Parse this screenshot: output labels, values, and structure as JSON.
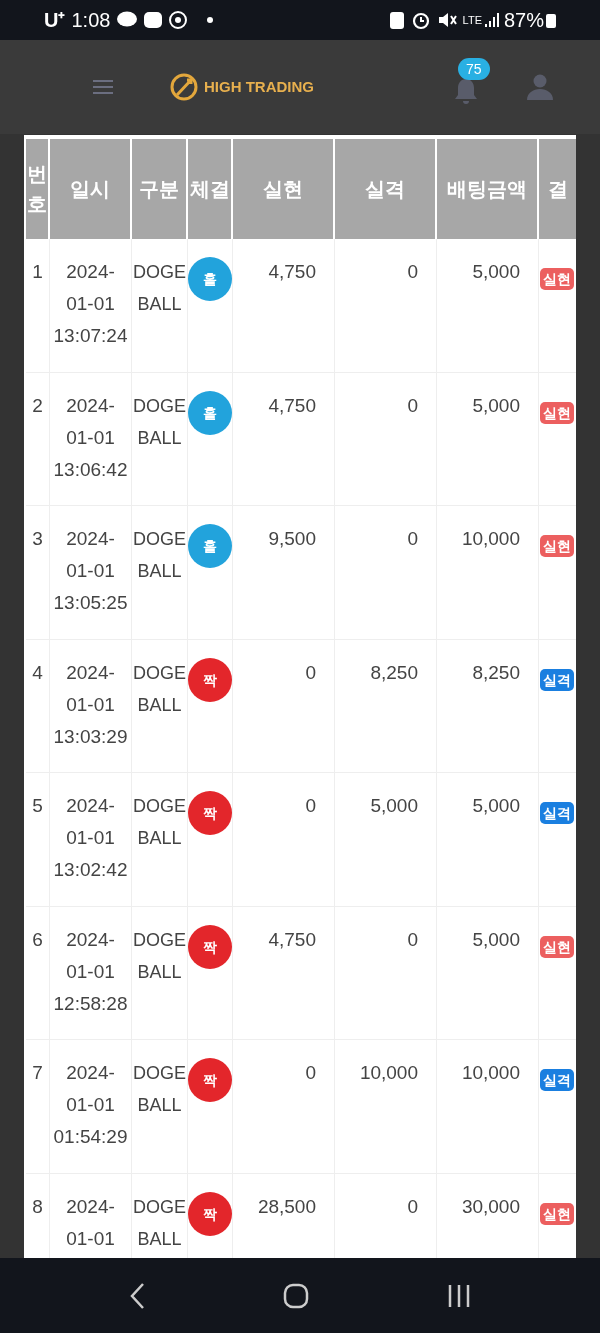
{
  "status_bar": {
    "carrier": "U⁺",
    "time": "1:08",
    "network": "LTE",
    "battery": "87%"
  },
  "header": {
    "brand": "HIGH TRADING",
    "notification_count": "75"
  },
  "table": {
    "columns": [
      "번\n호",
      "일시",
      "구분",
      "체결",
      "실현",
      "실격",
      "배팅금액",
      "결"
    ],
    "rows": [
      {
        "no": "1",
        "date": "2024-01-01",
        "time": "13:07:24",
        "game": "DOGE BALL",
        "fill": {
          "label": "홀",
          "color": "#22a3dc"
        },
        "realized": "4,750",
        "lost": "0",
        "bet": "5,000",
        "result": {
          "label": "실현",
          "color": "#ec5f5f"
        }
      },
      {
        "no": "2",
        "date": "2024-01-01",
        "time": "13:06:42",
        "game": "DOGE BALL",
        "fill": {
          "label": "홀",
          "color": "#22a3dc"
        },
        "realized": "4,750",
        "lost": "0",
        "bet": "5,000",
        "result": {
          "label": "실현",
          "color": "#ec5f5f"
        }
      },
      {
        "no": "3",
        "date": "2024-01-01",
        "time": "13:05:25",
        "game": "DOGE BALL",
        "fill": {
          "label": "홀",
          "color": "#22a3dc"
        },
        "realized": "9,500",
        "lost": "0",
        "bet": "10,000",
        "result": {
          "label": "실현",
          "color": "#ec5f5f"
        }
      },
      {
        "no": "4",
        "date": "2024-01-01",
        "time": "13:03:29",
        "game": "DOGE BALL",
        "fill": {
          "label": "짝",
          "color": "#e3262b"
        },
        "realized": "0",
        "lost": "8,250",
        "bet": "8,250",
        "result": {
          "label": "실격",
          "color": "#1a7fe0"
        }
      },
      {
        "no": "5",
        "date": "2024-01-01",
        "time": "13:02:42",
        "game": "DOGE BALL",
        "fill": {
          "label": "짝",
          "color": "#e3262b"
        },
        "realized": "0",
        "lost": "5,000",
        "bet": "5,000",
        "result": {
          "label": "실격",
          "color": "#1a7fe0"
        }
      },
      {
        "no": "6",
        "date": "2024-01-01",
        "time": "12:58:28",
        "game": "DOGE BALL",
        "fill": {
          "label": "짝",
          "color": "#e3262b"
        },
        "realized": "4,750",
        "lost": "0",
        "bet": "5,000",
        "result": {
          "label": "실현",
          "color": "#ec5f5f"
        }
      },
      {
        "no": "7",
        "date": "2024-01-01",
        "time": "01:54:29",
        "game": "DOGE BALL",
        "fill": {
          "label": "짝",
          "color": "#e3262b"
        },
        "realized": "0",
        "lost": "10,000",
        "bet": "10,000",
        "result": {
          "label": "실격",
          "color": "#1a7fe0"
        }
      },
      {
        "no": "8",
        "date": "2024-01-01",
        "game": "DOGE BALL",
        "fill": {
          "label": "짝",
          "color": "#e3262b"
        },
        "realized": "28,500",
        "lost": "0",
        "bet": "30,000",
        "result": {
          "label": "실현",
          "color": "#ec5f5f"
        }
      }
    ]
  }
}
